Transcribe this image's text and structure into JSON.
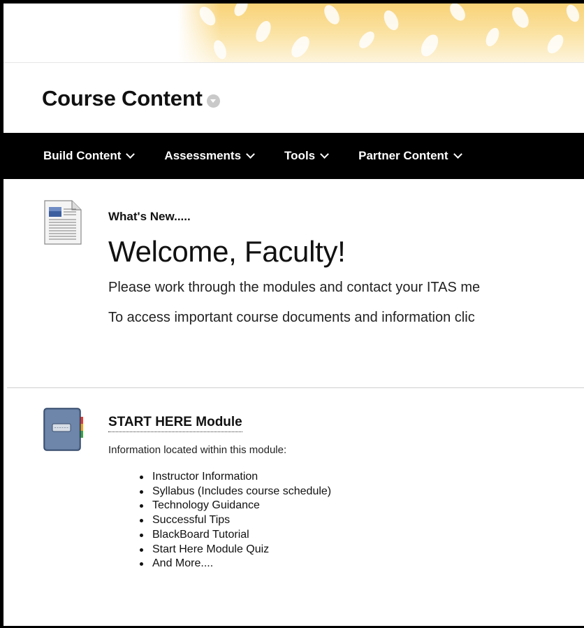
{
  "page": {
    "title": "Course Content"
  },
  "action_bar": {
    "items": [
      {
        "label": "Build Content"
      },
      {
        "label": "Assessments"
      },
      {
        "label": "Tools"
      },
      {
        "label": "Partner Content"
      }
    ]
  },
  "content_items": {
    "whats_new": {
      "heading": "What's New.....",
      "welcome": "Welcome, Faculty!",
      "paragraph1": "Please work through the modules and contact your ITAS me",
      "paragraph2": "To access important course documents and information clic"
    },
    "start_here": {
      "title": "START HERE Module",
      "subtitle": "Information located within this module:",
      "list": [
        "Instructor Information",
        "Syllabus (Includes course schedule)",
        "Technology Guidance",
        "Successful Tips",
        "BlackBoard Tutorial",
        "Start Here Module Quiz",
        "And More...."
      ]
    }
  },
  "icons": {
    "document_icon": "document-icon",
    "module_icon": "learning-module-icon",
    "title_menu": "chevron-down-icon"
  },
  "colors": {
    "action_bar_bg": "#000000",
    "banner_accent": "#f5c54a",
    "frame_border": "#000000"
  }
}
